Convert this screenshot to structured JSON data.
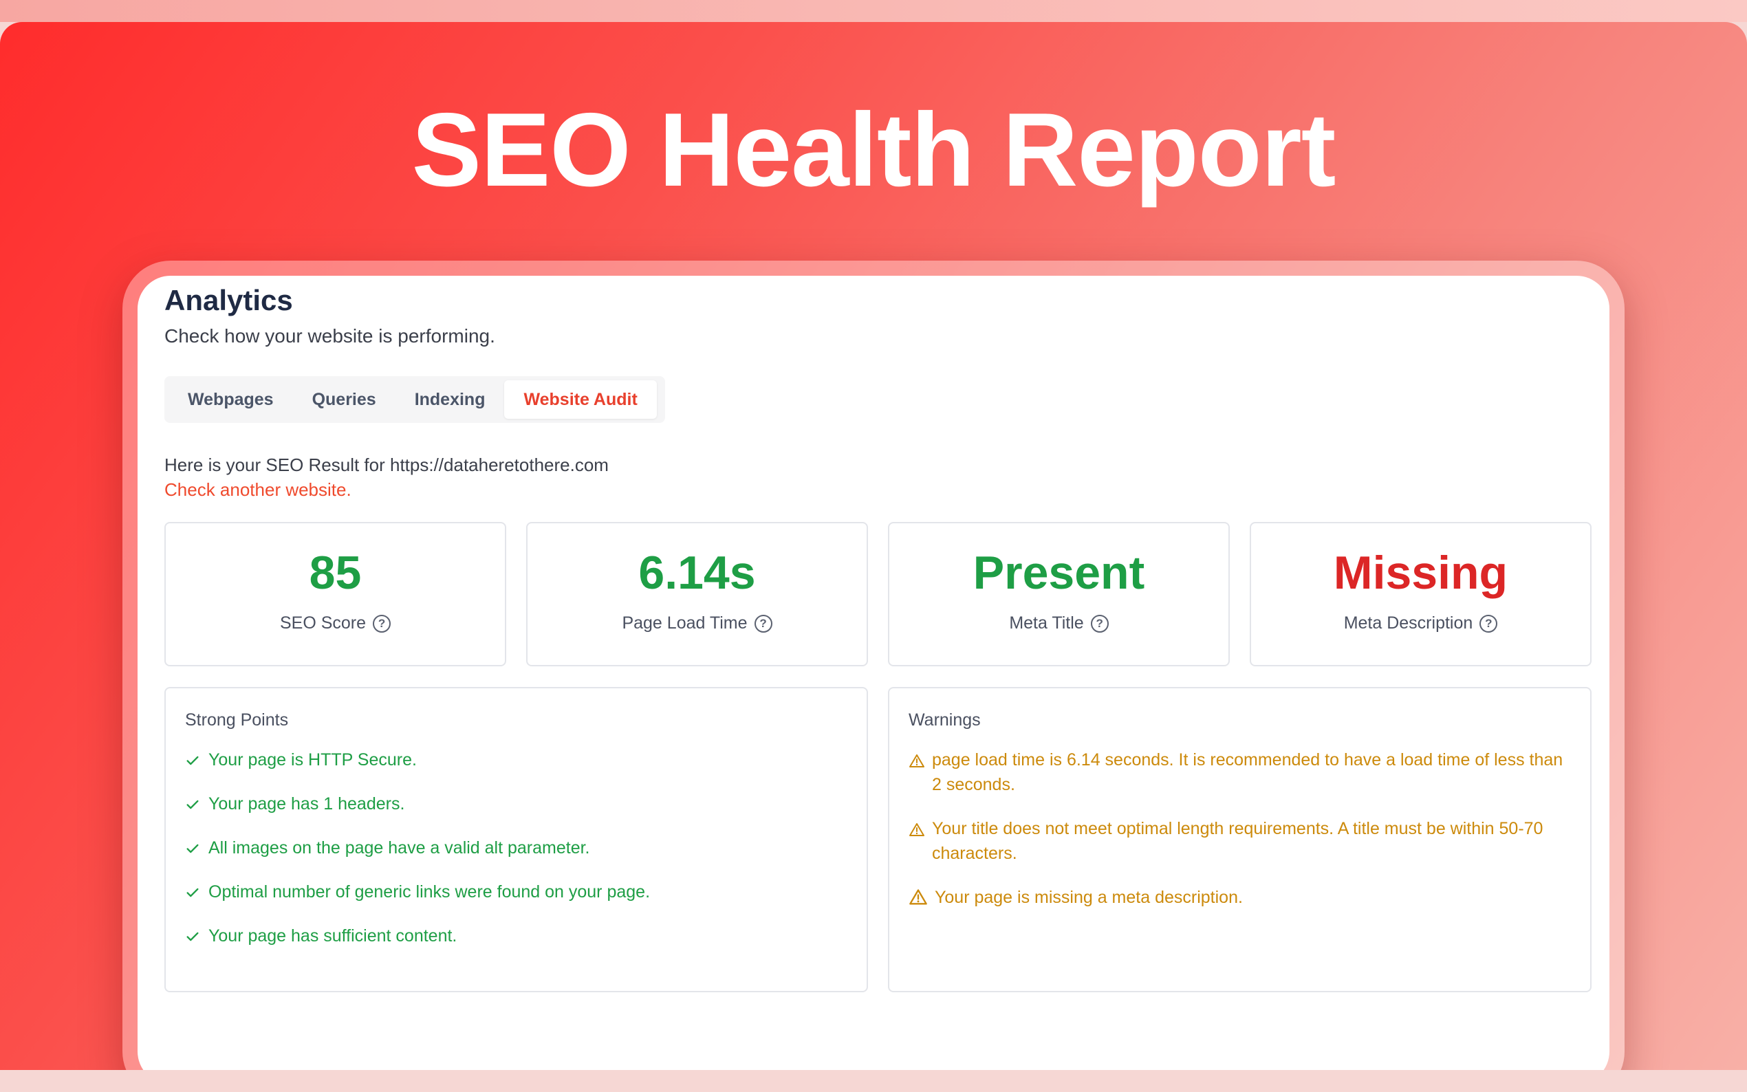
{
  "hero": {
    "title": "SEO Health Report"
  },
  "analytics": {
    "title": "Analytics",
    "subtitle": "Check how your website is performing.",
    "tabs": [
      {
        "label": "Webpages",
        "active": false
      },
      {
        "label": "Queries",
        "active": false
      },
      {
        "label": "Indexing",
        "active": false
      },
      {
        "label": "Website Audit",
        "active": true
      }
    ],
    "result_text": "Here is your SEO Result for https://dataheretothere.com",
    "check_another_link": "Check another website."
  },
  "metrics": [
    {
      "value": "85",
      "label": "SEO Score",
      "status": "good"
    },
    {
      "value": "6.14s",
      "label": "Page Load Time",
      "status": "good"
    },
    {
      "value": "Present",
      "label": "Meta Title",
      "status": "good"
    },
    {
      "value": "Missing",
      "label": "Meta Description",
      "status": "bad"
    }
  ],
  "strong_points": {
    "title": "Strong Points",
    "items": [
      "Your page is HTTP Secure.",
      "Your page has 1 headers.",
      "All images on the page have a valid alt parameter.",
      "Optimal number of generic links were found on your page.",
      "Your page has sufficient content."
    ]
  },
  "warnings": {
    "title": "Warnings",
    "items": [
      "page load time is 6.14 seconds. It is recommended to have a load time of less than 2 seconds.",
      "Your title does not meet optimal length requirements. A title must be within 50-70 characters.",
      "Your page is missing a meta description."
    ]
  },
  "colors": {
    "accent": "#ef4a2d",
    "good": "#1e9e45",
    "bad": "#dc2626",
    "warning": "#cc8a0c",
    "hero_gradient_start": "#ff2c2c",
    "hero_gradient_end": "#f8b0a7"
  },
  "icons": {
    "help": "question-circle-icon",
    "check": "check-icon",
    "warning": "warning-triangle-icon"
  }
}
